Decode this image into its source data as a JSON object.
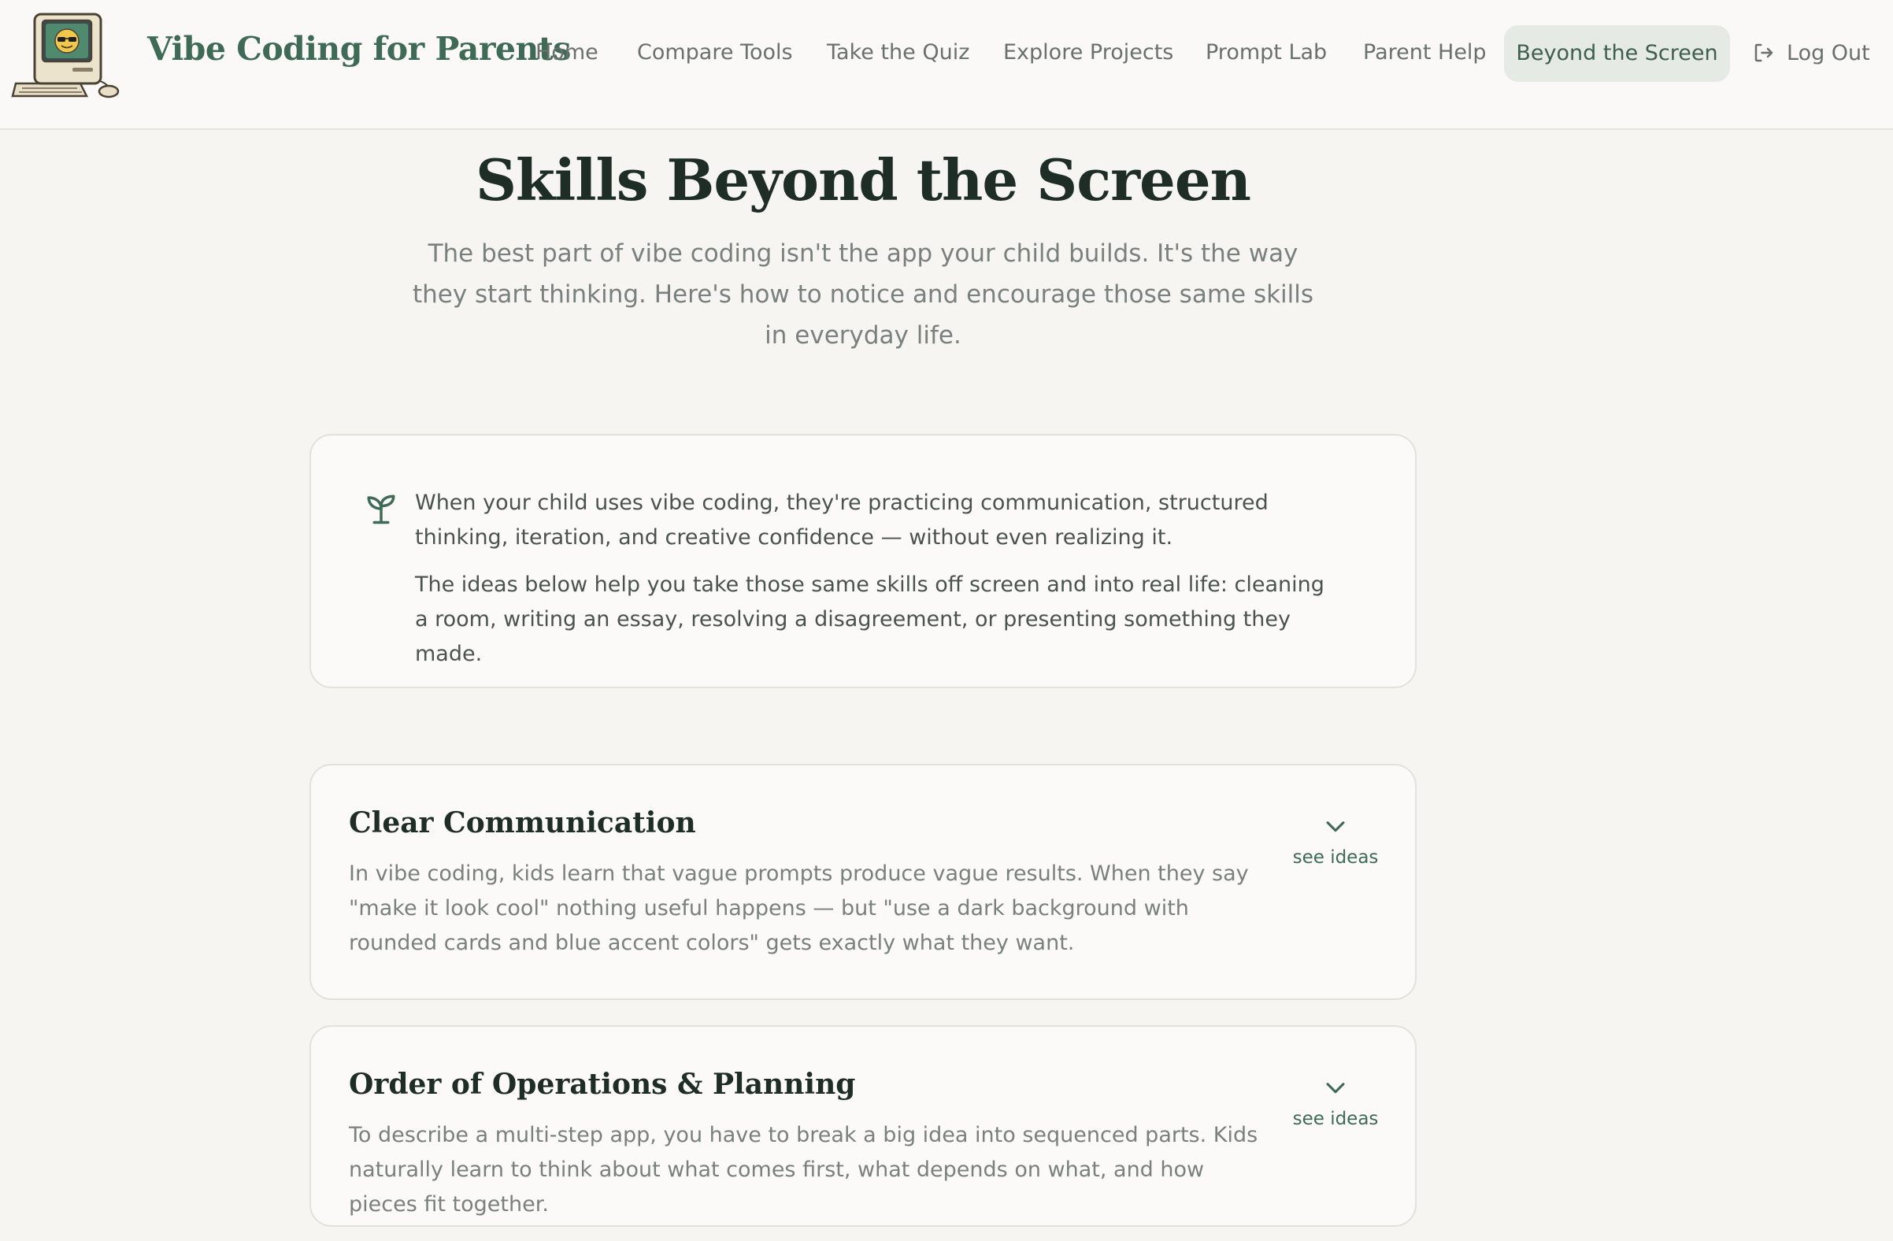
{
  "header": {
    "brand": "Vibe Coding for Parents",
    "logo_icon": "retro-computer-sunglasses-logo",
    "nav": [
      {
        "label": "Home"
      },
      {
        "label": "Compare Tools"
      },
      {
        "label": "Take the Quiz"
      },
      {
        "label": "Explore Projects"
      },
      {
        "label": "Prompt Lab"
      },
      {
        "label": "Parent Help"
      }
    ],
    "active_nav": "Beyond the Screen",
    "logout_label": "Log Out",
    "logout_icon": "logout-icon"
  },
  "hero": {
    "title": "Skills Beyond the Screen",
    "subtitle": "The best part of vibe coding isn't the app your child builds. It's the way they start thinking. Here's how to notice and encourage those same skills in everyday life."
  },
  "intro": {
    "icon": "sprout-icon",
    "paragraph1": "When your child uses vibe coding, they're practicing communication, structured thinking, iteration, and creative confidence — without even realizing it.",
    "paragraph2": "The ideas below help you take those same skills off screen and into real life: cleaning a room, writing an essay, resolving a disagreement, or presenting something they made."
  },
  "skills": [
    {
      "title": "Clear Communication",
      "description": "In vibe coding, kids learn that vague prompts produce vague results. When they say \"make it look cool\" nothing useful happens — but \"use a dark background with rounded cards and blue accent colors\" gets exactly what they want.",
      "toggle_label": "see ideas"
    },
    {
      "title": "Order of Operations & Planning",
      "description": "To describe a multi-step app, you have to break a big idea into sequenced parts. Kids naturally learn to think about what comes first, what depends on what, and how pieces fit together.",
      "toggle_label": "see ideas"
    }
  ],
  "colors": {
    "background": "#f6f5f1",
    "brand_green": "#3f6a56",
    "active_nav_bg": "#e6eae4",
    "heading": "#1f2d27",
    "muted_text": "#7a817c"
  }
}
